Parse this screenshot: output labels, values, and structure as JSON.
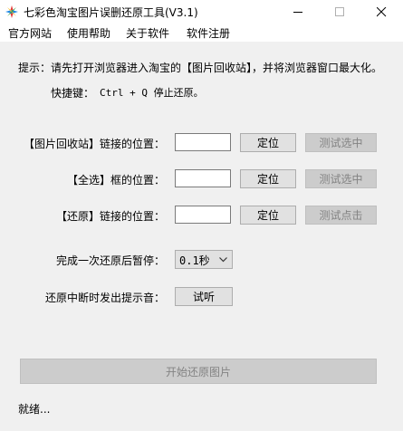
{
  "window": {
    "title": "七彩色淘宝图片误删还原工具(V3.1)"
  },
  "menu": {
    "items": [
      {
        "label": "官方网站"
      },
      {
        "label": "使用帮助"
      },
      {
        "label": "关于软件"
      },
      {
        "label": "软件注册"
      }
    ]
  },
  "main": {
    "tip": "提示：请先打开浏览器进入淘宝的【图片回收站】，并将浏览器窗口最大化。",
    "shortcut_label": "快捷键：",
    "shortcut_value": "Ctrl + Q 停止还原。",
    "rows": [
      {
        "label": "【图片回收站】链接的位置：",
        "locate": "定位",
        "test": "测试选中"
      },
      {
        "label": "【全选】框的位置：",
        "locate": "定位",
        "test": "测试选中"
      },
      {
        "label": "【还原】链接的位置：",
        "locate": "定位",
        "test": "测试点击"
      }
    ],
    "pause_label": "完成一次还原后暂停：",
    "pause_value": "0.1秒",
    "sound_label": "还原中断时发出提示音：",
    "listen_button": "试听",
    "start_button": "开始还原图片",
    "status": "就绪..."
  },
  "colors": {
    "window_bg": "#f0f0f0",
    "disabled_text": "#838383"
  }
}
